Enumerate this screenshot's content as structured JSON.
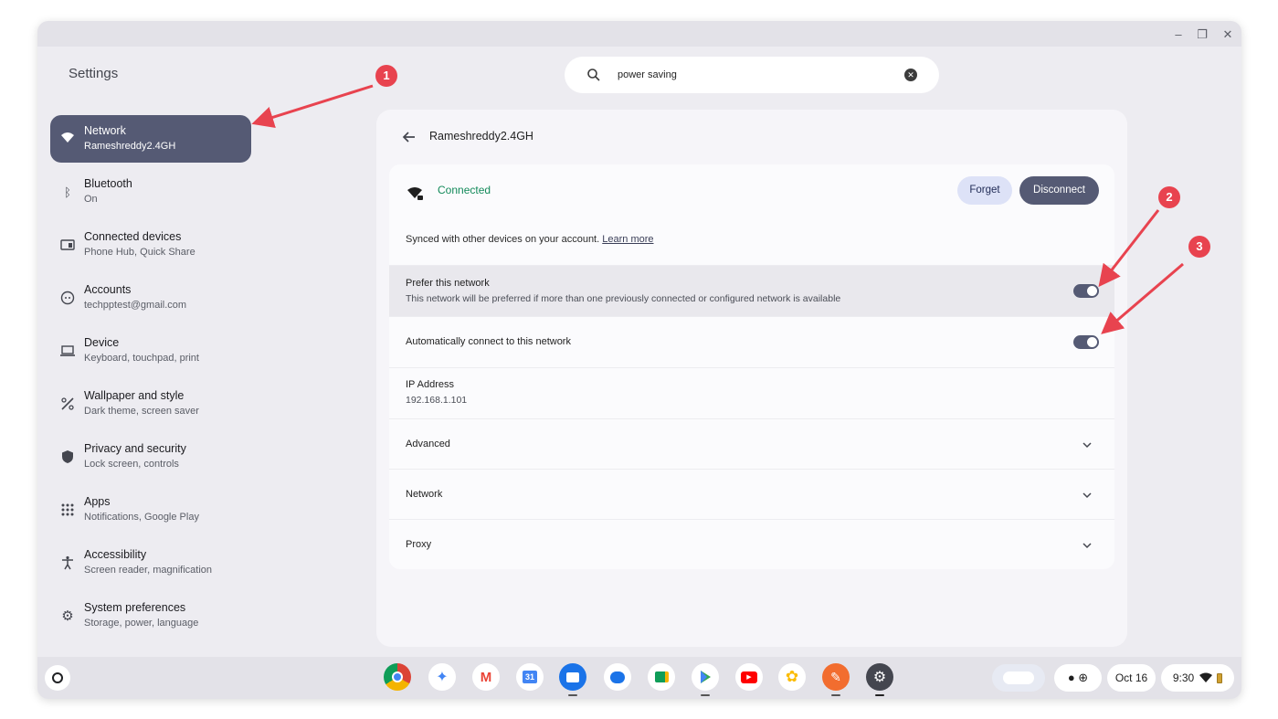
{
  "window": {
    "minimize_icon": "minimize-icon",
    "restore_icon": "restore-icon",
    "close_icon": "close-icon"
  },
  "app_title": "Settings",
  "search": {
    "value": "power saving",
    "placeholder": ""
  },
  "sidebar": {
    "items": [
      {
        "title": "Network",
        "subtitle": "Rameshreddy2.4GH",
        "icon": "wifi-icon",
        "active": true
      },
      {
        "title": "Bluetooth",
        "subtitle": "On",
        "icon": "bluetooth-icon"
      },
      {
        "title": "Connected devices",
        "subtitle": "Phone Hub, Quick Share",
        "icon": "connected-devices-icon"
      },
      {
        "title": "Accounts",
        "subtitle": "techpptest@gmail.com",
        "icon": "account-icon"
      },
      {
        "title": "Device",
        "subtitle": "Keyboard, touchpad, print",
        "icon": "laptop-icon"
      },
      {
        "title": "Wallpaper and style",
        "subtitle": "Dark theme, screen saver",
        "icon": "palette-icon"
      },
      {
        "title": "Privacy and security",
        "subtitle": "Lock screen, controls",
        "icon": "shield-icon"
      },
      {
        "title": "Apps",
        "subtitle": "Notifications, Google Play",
        "icon": "apps-grid-icon"
      },
      {
        "title": "Accessibility",
        "subtitle": "Screen reader, magnification",
        "icon": "accessibility-icon"
      },
      {
        "title": "System preferences",
        "subtitle": "Storage, power, language",
        "icon": "gear-icon"
      }
    ]
  },
  "detail": {
    "title": "Rameshreddy2.4GH",
    "status": "Connected",
    "forget_label": "Forget",
    "disconnect_label": "Disconnect",
    "sync_text": "Synced with other devices on your account.",
    "learn_more": "Learn more",
    "prefer_title": "Prefer this network",
    "prefer_sub": "This network will be preferred if more than one previously connected or configured network is available",
    "prefer_on": true,
    "auto_title": "Automatically connect to this network",
    "auto_on": true,
    "ip_title": "IP Address",
    "ip_value": "192.168.1.101",
    "sections": [
      "Advanced",
      "Network",
      "Proxy"
    ]
  },
  "annotations": [
    "1",
    "2",
    "3"
  ],
  "shelf": {
    "apps": [
      "Chrome",
      "Gemini",
      "Gmail",
      "Calendar",
      "Files",
      "Messages",
      "Meet",
      "Play Store",
      "YouTube",
      "Photos",
      "Cursive",
      "Settings"
    ],
    "calendar_day": "31",
    "date": "Oct 16",
    "time": "9:30"
  },
  "colors": {
    "accent": "#555a74",
    "connected": "#138a5a",
    "annotation": "#e8434f",
    "window_bg": "#edecf1"
  }
}
